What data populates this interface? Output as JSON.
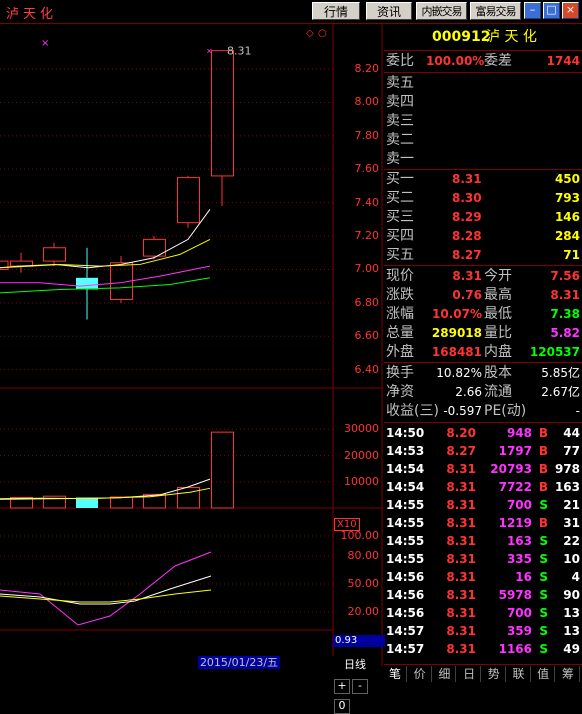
{
  "window": {
    "title": "泸天化",
    "buttons": [
      "行情",
      "资讯",
      "内嵌交易",
      "富易交易"
    ]
  },
  "quote": {
    "code": "000912",
    "name": "泸 天 化",
    "weibi_label": "委比",
    "weibi_value": "100.00%",
    "weicha_label": "委差",
    "weicha_value": "1744",
    "asks": [
      {
        "label": "卖五",
        "price": "",
        "vol": ""
      },
      {
        "label": "卖四",
        "price": "",
        "vol": ""
      },
      {
        "label": "卖三",
        "price": "",
        "vol": ""
      },
      {
        "label": "卖二",
        "price": "",
        "vol": ""
      },
      {
        "label": "卖一",
        "price": "",
        "vol": ""
      }
    ],
    "bids": [
      {
        "label": "买一",
        "price": "8.31",
        "vol": "450"
      },
      {
        "label": "买二",
        "price": "8.30",
        "vol": "793"
      },
      {
        "label": "买三",
        "price": "8.29",
        "vol": "146"
      },
      {
        "label": "买四",
        "price": "8.28",
        "vol": "284"
      },
      {
        "label": "买五",
        "price": "8.27",
        "vol": "71"
      }
    ],
    "stats": [
      {
        "l1": "现价",
        "v1": "8.31",
        "l2": "今开",
        "v2": "7.56"
      },
      {
        "l1": "涨跌",
        "v1": "0.76",
        "l2": "最高",
        "v2": "8.31"
      },
      {
        "l1": "涨幅",
        "v1": "10.07%",
        "l2": "最低",
        "v2": "7.38"
      },
      {
        "l1": "总量",
        "v1": "289018",
        "l2": "量比",
        "v2": "5.82"
      },
      {
        "l1": "外盘",
        "v1": "168481",
        "l2": "内盘",
        "v2": "120537"
      }
    ],
    "fund": [
      {
        "l1": "换手",
        "v1": "10.82%",
        "l2": "股本",
        "v2": "5.85亿"
      },
      {
        "l1": "净资",
        "v1": "2.66",
        "l2": "流通",
        "v2": "2.67亿"
      },
      {
        "l1": "收益(三)",
        "v1": "-0.597",
        "l2": "PE(动)",
        "v2": "-"
      }
    ],
    "ticks": [
      {
        "time": "14:50",
        "price": "8.20",
        "vol": "948",
        "bs": "B",
        "n": "44"
      },
      {
        "time": "14:53",
        "price": "8.27",
        "vol": "1797",
        "bs": "B",
        "n": "77"
      },
      {
        "time": "14:54",
        "price": "8.31",
        "vol": "20793",
        "bs": "B",
        "n": "978"
      },
      {
        "time": "14:54",
        "price": "8.31",
        "vol": "7722",
        "bs": "B",
        "n": "163"
      },
      {
        "time": "14:55",
        "price": "8.31",
        "vol": "700",
        "bs": "S",
        "n": "21"
      },
      {
        "time": "14:55",
        "price": "8.31",
        "vol": "1219",
        "bs": "B",
        "n": "31"
      },
      {
        "time": "14:55",
        "price": "8.31",
        "vol": "163",
        "bs": "S",
        "n": "22"
      },
      {
        "time": "14:55",
        "price": "8.31",
        "vol": "335",
        "bs": "S",
        "n": "10"
      },
      {
        "time": "14:56",
        "price": "8.31",
        "vol": "16",
        "bs": "S",
        "n": "4"
      },
      {
        "time": "14:56",
        "price": "8.31",
        "vol": "5978",
        "bs": "S",
        "n": "90"
      },
      {
        "time": "14:56",
        "price": "8.31",
        "vol": "700",
        "bs": "S",
        "n": "13"
      },
      {
        "time": "14:57",
        "price": "8.31",
        "vol": "359",
        "bs": "S",
        "n": "13"
      },
      {
        "time": "14:57",
        "price": "8.31",
        "vol": "1166",
        "bs": "S",
        "n": "49"
      }
    ],
    "tabs": [
      "笔",
      "价",
      "细",
      "日",
      "势",
      "联",
      "值",
      "筹"
    ]
  },
  "chart": {
    "price_axis": [
      "8.20",
      "8.00",
      "7.80",
      "7.60",
      "7.40",
      "7.20",
      "7.00",
      "6.80",
      "6.60",
      "6.40"
    ],
    "vol_axis": [
      "30000",
      "20000",
      "10000"
    ],
    "vol_unit": "X10",
    "ind_axis": [
      "100.00",
      "80.00",
      "50.00",
      "20.00"
    ],
    "ind_value": "0.93",
    "last_price_label": "8.31",
    "date": "2015/01/23/五",
    "period": "日线",
    "zoom": [
      "+",
      "-",
      "0"
    ]
  },
  "chart_data": {
    "type": "candlestick",
    "candles": [
      {
        "open": 7.02,
        "close": 7.05,
        "high": 7.1,
        "low": 6.98,
        "color": "red"
      },
      {
        "open": 7.05,
        "close": 7.13,
        "high": 7.16,
        "low": 7.02,
        "color": "red"
      },
      {
        "open": 6.95,
        "close": 6.88,
        "high": 7.13,
        "low": 6.7,
        "color": "cyan"
      },
      {
        "open": 6.82,
        "close": 7.04,
        "high": 7.08,
        "low": 6.8,
        "color": "red"
      },
      {
        "open": 7.08,
        "close": 7.18,
        "high": 7.2,
        "low": 7.06,
        "color": "red"
      },
      {
        "open": 7.28,
        "close": 7.55,
        "high": 7.56,
        "low": 7.25,
        "color": "red"
      },
      {
        "open": 7.56,
        "close": 8.31,
        "high": 8.31,
        "low": 7.38,
        "color": "red"
      }
    ],
    "volumes": [
      4000,
      4500,
      4000,
      4200,
      5200,
      7800,
      28901
    ],
    "ylim": [
      6.35,
      8.35
    ],
    "vol_ylim": [
      0,
      32000
    ]
  }
}
